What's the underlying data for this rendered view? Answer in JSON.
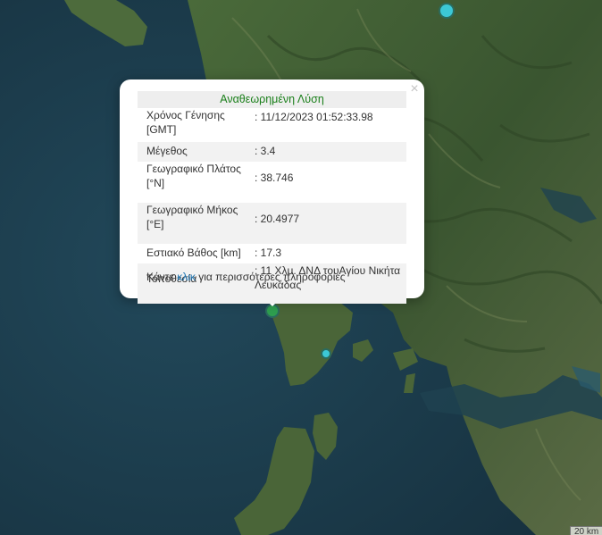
{
  "popup": {
    "title": "Αναθεωρημένη Λύση",
    "rows": [
      {
        "label": "Χρόνος Γένησης [GMT]",
        "value": ": 11/12/2023 01:52:33.98"
      },
      {
        "label": "Μέγεθος",
        "value": ": 3.4"
      },
      {
        "label": "Γεωγραφικό Πλάτος [°N]",
        "value": ": 38.746"
      },
      {
        "label": "Γεωγραφικό Μήκος [°E]",
        "value": ": 20.4977"
      },
      {
        "label": "Εστιακό Βάθος [km]",
        "value": ": 17.3"
      },
      {
        "label": "Τοποθεσία",
        "value": ": 11 Χλμ. ΔΝΔ τουΑγίου Νικήτα Λευκάδας"
      }
    ],
    "more_prefix": "Κάντε ",
    "more_link": "κλικ",
    "more_suffix": " για περισσότερες πληροφορίες",
    "close_symbol": "×"
  },
  "markers": [
    {
      "name": "selected",
      "color": "#2e9e4f"
    },
    {
      "name": "north",
      "color": "#3cc8d6"
    },
    {
      "name": "lefkada",
      "color": "#3cc8d6"
    }
  ],
  "scale_label": "20 km",
  "colors": {
    "sea": "#1d3a4a",
    "land": "#3d5a32",
    "popup_title": "#1a7f1a",
    "link": "#2077b4"
  }
}
